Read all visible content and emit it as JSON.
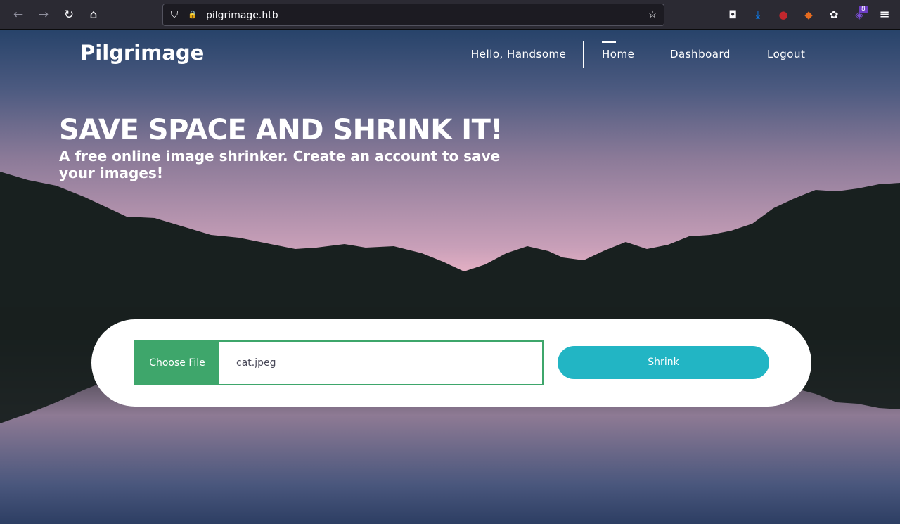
{
  "browser": {
    "url": "pilgrimage.htb",
    "back_icon": "←",
    "forward_icon": "→",
    "reload_icon": "↻",
    "home_icon": "⌂",
    "shield_icon": "⛉",
    "lock_icon": "🔒",
    "bookmark_icon": "☆",
    "pocket_icon": "◘",
    "download_icon": "⤓",
    "ublock_icon": "●",
    "fox_icon": "◆",
    "cookie_icon": "✿",
    "extension_icon": "◈",
    "extension_badge": "8",
    "menu_icon": "≡"
  },
  "site": {
    "brand": "Pilgrimage",
    "nav": {
      "greeting": "Hello, Handsome",
      "home": "Home",
      "dashboard": "Dashboard",
      "logout": "Logout"
    },
    "hero": {
      "title": "SAVE SPACE AND SHRINK IT!",
      "subtitle": "A free online image shrinker. Create an account to save your images!"
    },
    "upload": {
      "choose_label": "Choose File",
      "file_name": "cat.jpeg",
      "shrink_label": "Shrink"
    }
  },
  "colors": {
    "accent_green": "#3ea66b",
    "shrink_teal": "#22b5c4",
    "mountain": "#18201f"
  }
}
